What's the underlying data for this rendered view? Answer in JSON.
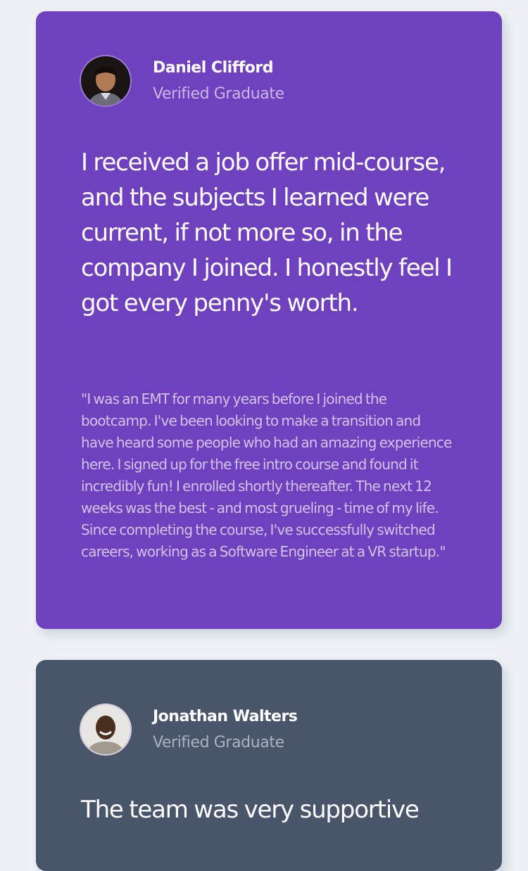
{
  "testimonials": [
    {
      "name": "Daniel Clifford",
      "role": "Verified Graduate",
      "avatar": "avatar-photo",
      "background": "#7041bf",
      "headline": "I received a job offer mid-course, and the subjects I learned were current, if not more so, in the company I joined. I honestly feel I got every penny's worth.",
      "quote": "\"I was an EMT for many years before I joined the bootcamp. I've been looking to make a transition and have heard some people who had an amazing experience here. I signed up for the free intro course and found it incredibly fun! I enrolled shortly thereafter. The next 12 weeks was the best - and most grueling - time of my life. Since completing the course, I've successfully switched careers, working as a Software Engineer at a VR startup.\""
    },
    {
      "name": "Jonathan Walters",
      "role": "Verified Graduate",
      "avatar": "avatar-photo",
      "background": "#48556a",
      "headline": "The team was very supportive"
    }
  ],
  "page_background": "#edf1f5"
}
